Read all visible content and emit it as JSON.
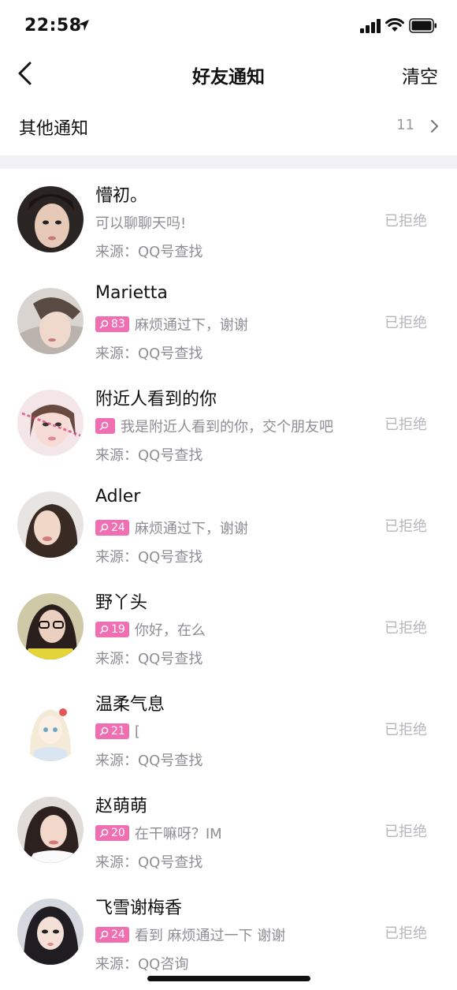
{
  "status_bar": {
    "time": "22:58"
  },
  "nav": {
    "title": "好友通知",
    "clear_label": "清空"
  },
  "other": {
    "label": "其他通知",
    "count": "11"
  },
  "items": [
    {
      "name": "懵初。",
      "badge": null,
      "message": "可以聊聊天吗!",
      "source": "来源：QQ号查找",
      "status": "已拒绝"
    },
    {
      "name": "Marietta",
      "badge": "83",
      "message": "麻烦通过下，谢谢",
      "source": "来源：QQ号查找",
      "status": "已拒绝"
    },
    {
      "name": "附近人看到的你",
      "badge": "",
      "message": "我是附近人看到的你，交个朋友吧",
      "source": "来源：QQ号查找",
      "status": "已拒绝"
    },
    {
      "name": "Adler",
      "badge": "24",
      "message": "麻烦通过下，谢谢",
      "source": "来源：QQ号查找",
      "status": "已拒绝"
    },
    {
      "name": "野丫头",
      "badge": "19",
      "message": "你好，在么",
      "source": "来源：QQ号查找",
      "status": "已拒绝"
    },
    {
      "name": "温柔气息",
      "badge": "21",
      "message": "[",
      "source": "来源：QQ号查找",
      "status": "已拒绝"
    },
    {
      "name": "赵萌萌",
      "badge": "20",
      "message": "在干嘛呀？IM",
      "source": "来源：QQ号查找",
      "status": "已拒绝"
    },
    {
      "name": "飞雪谢梅香",
      "badge": "24",
      "message": "看到 麻烦通过一下 谢谢",
      "source": "来源：QQ咨询",
      "status": "已拒绝"
    }
  ],
  "colors": {
    "badge": "#f06fb2",
    "secondary_text": "#8e8e95",
    "status_text": "#b6b6bc",
    "divider": "#f2f2f6"
  }
}
